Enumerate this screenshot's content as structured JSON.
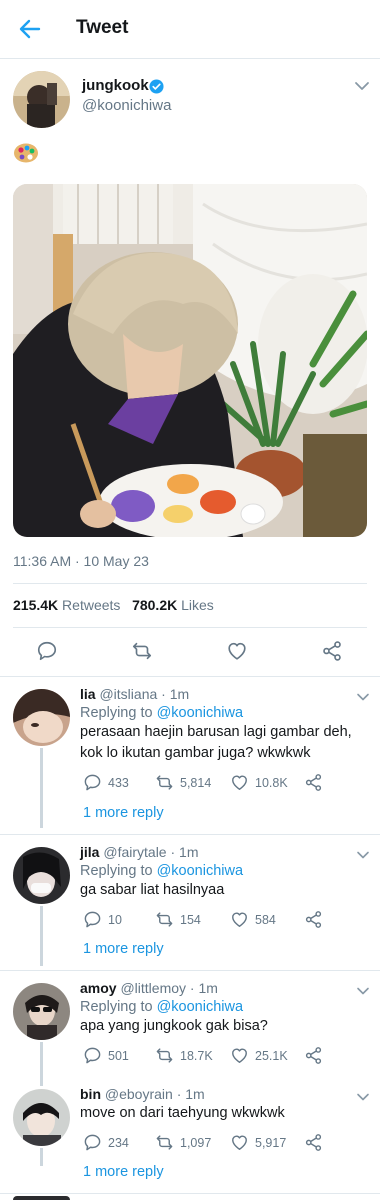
{
  "header": {
    "title": "Tweet"
  },
  "author": {
    "name": "jungkook",
    "handle": "@koonichiwa"
  },
  "tweet": {
    "emoji": "🎨",
    "timestamp": "11:36 AM · 10 May 23"
  },
  "stats": {
    "retweets_count": "215.4K",
    "retweets_label": "Retweets",
    "likes_count": "780.2K",
    "likes_label": "Likes"
  },
  "replies": [
    {
      "name": "lia",
      "meta": "@itsliana · 1m",
      "replying_prefix": "Replying to",
      "replying_to": "@koonichiwa",
      "text": "perasaan haejin barusan lagi gambar deh, kok lo ikutan gambar juga? wkwkwk",
      "reply_count": "433",
      "retweet_count": "5,814",
      "like_count": "10.8K",
      "more": "1 more reply"
    },
    {
      "name": "jila",
      "meta": "@fairytale · 1m",
      "replying_prefix": "Replying to",
      "replying_to": "@koonichiwa",
      "text": "ga sabar liat hasilnyaa",
      "reply_count": "10",
      "retweet_count": "154",
      "like_count": "584",
      "more": "1 more reply"
    },
    {
      "name": "amoy",
      "meta": "@littlemoy · 1m",
      "replying_prefix": "Replying to",
      "replying_to": "@koonichiwa",
      "text": "apa yang jungkook gak bisa?",
      "reply_count": "501",
      "retweet_count": "18.7K",
      "like_count": "25.1K"
    },
    {
      "name": "bin",
      "meta": "@eboyrain · 1m",
      "text": "move on dari taehyung wkwkwk",
      "reply_count": "234",
      "retweet_count": "1,097",
      "like_count": "5,917",
      "more": "1 more reply"
    }
  ],
  "colors": {
    "accent": "#1da1f2",
    "link": "#1b95e0",
    "muted": "#657786",
    "border": "#e1e8ed"
  }
}
